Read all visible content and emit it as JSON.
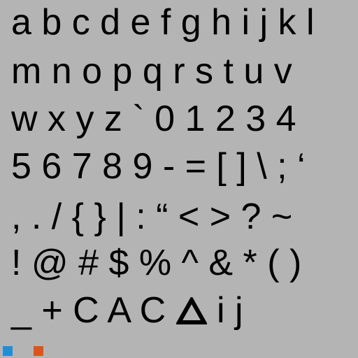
{
  "glyph_sheet": {
    "rows": [
      "a b c d e f g h i j k l",
      "m n o p q r s t u v",
      "w x y z ` 0 1 2 3 4",
      "5 6 7 8 9 - = [ ] \\ ; ‘",
      ", . / { } | : “ < > ? ~",
      "! @ # $ % ^ & * ( )",
      "_ + C A C",
      "i j"
    ],
    "triangle_icon": "triangle-outline-icon"
  },
  "swatches": {
    "blue": "#1f8fd6",
    "orange": "#e0521a"
  },
  "colors": {
    "background": "#b4b4b4",
    "text": "#000000"
  }
}
